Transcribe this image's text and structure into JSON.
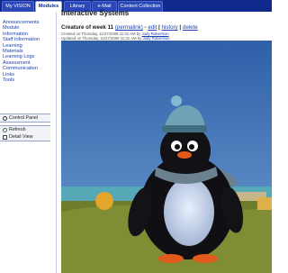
{
  "tabs": [
    {
      "label": "My VISION",
      "active": false
    },
    {
      "label": "Modules",
      "active": true
    },
    {
      "label": "Library",
      "active": false
    },
    {
      "label": "e-Mail",
      "active": false
    },
    {
      "label": "Content Collection",
      "active": false
    }
  ],
  "sidebar": {
    "items": [
      {
        "label": "Announcements"
      },
      {
        "label": "Module"
      },
      {
        "label": "Information"
      },
      {
        "label": "Staff Information"
      },
      {
        "label": "Learning"
      },
      {
        "label": "Materials"
      },
      {
        "label": "Learning Logs"
      },
      {
        "label": "Assessment"
      },
      {
        "label": "Communication"
      },
      {
        "label": "Links"
      },
      {
        "label": "Tools"
      }
    ],
    "control_panel": {
      "label": "Control Panel",
      "icon": "control-panel-icon"
    },
    "actions": [
      {
        "label": "Refresh",
        "icon": "refresh-icon"
      },
      {
        "label": "Detail View",
        "icon": "detail-view-icon"
      }
    ]
  },
  "main": {
    "page_title": "Interactive Systems",
    "entry": {
      "title": "Creature of week 11",
      "permalink": "(permalink)",
      "sep1": " - ",
      "edit": "edit",
      "sep2": " | ",
      "history": "history",
      "sep3": " | ",
      "delete": "delete",
      "created": "Created on Thursday, 11/27/2008 11:31 AM by",
      "created_author": "Judy Robertson",
      "updated": "Updated on Thursday, 11/27/2008 11:31 AM by",
      "updated_author": "Judy Robertson"
    }
  },
  "colors": {
    "tabbar_bg": "#0f2a8c",
    "link": "#1b3fae",
    "sky": "#3e6fb6",
    "water": "#57a9b8",
    "ground": "#6d7d2c"
  }
}
